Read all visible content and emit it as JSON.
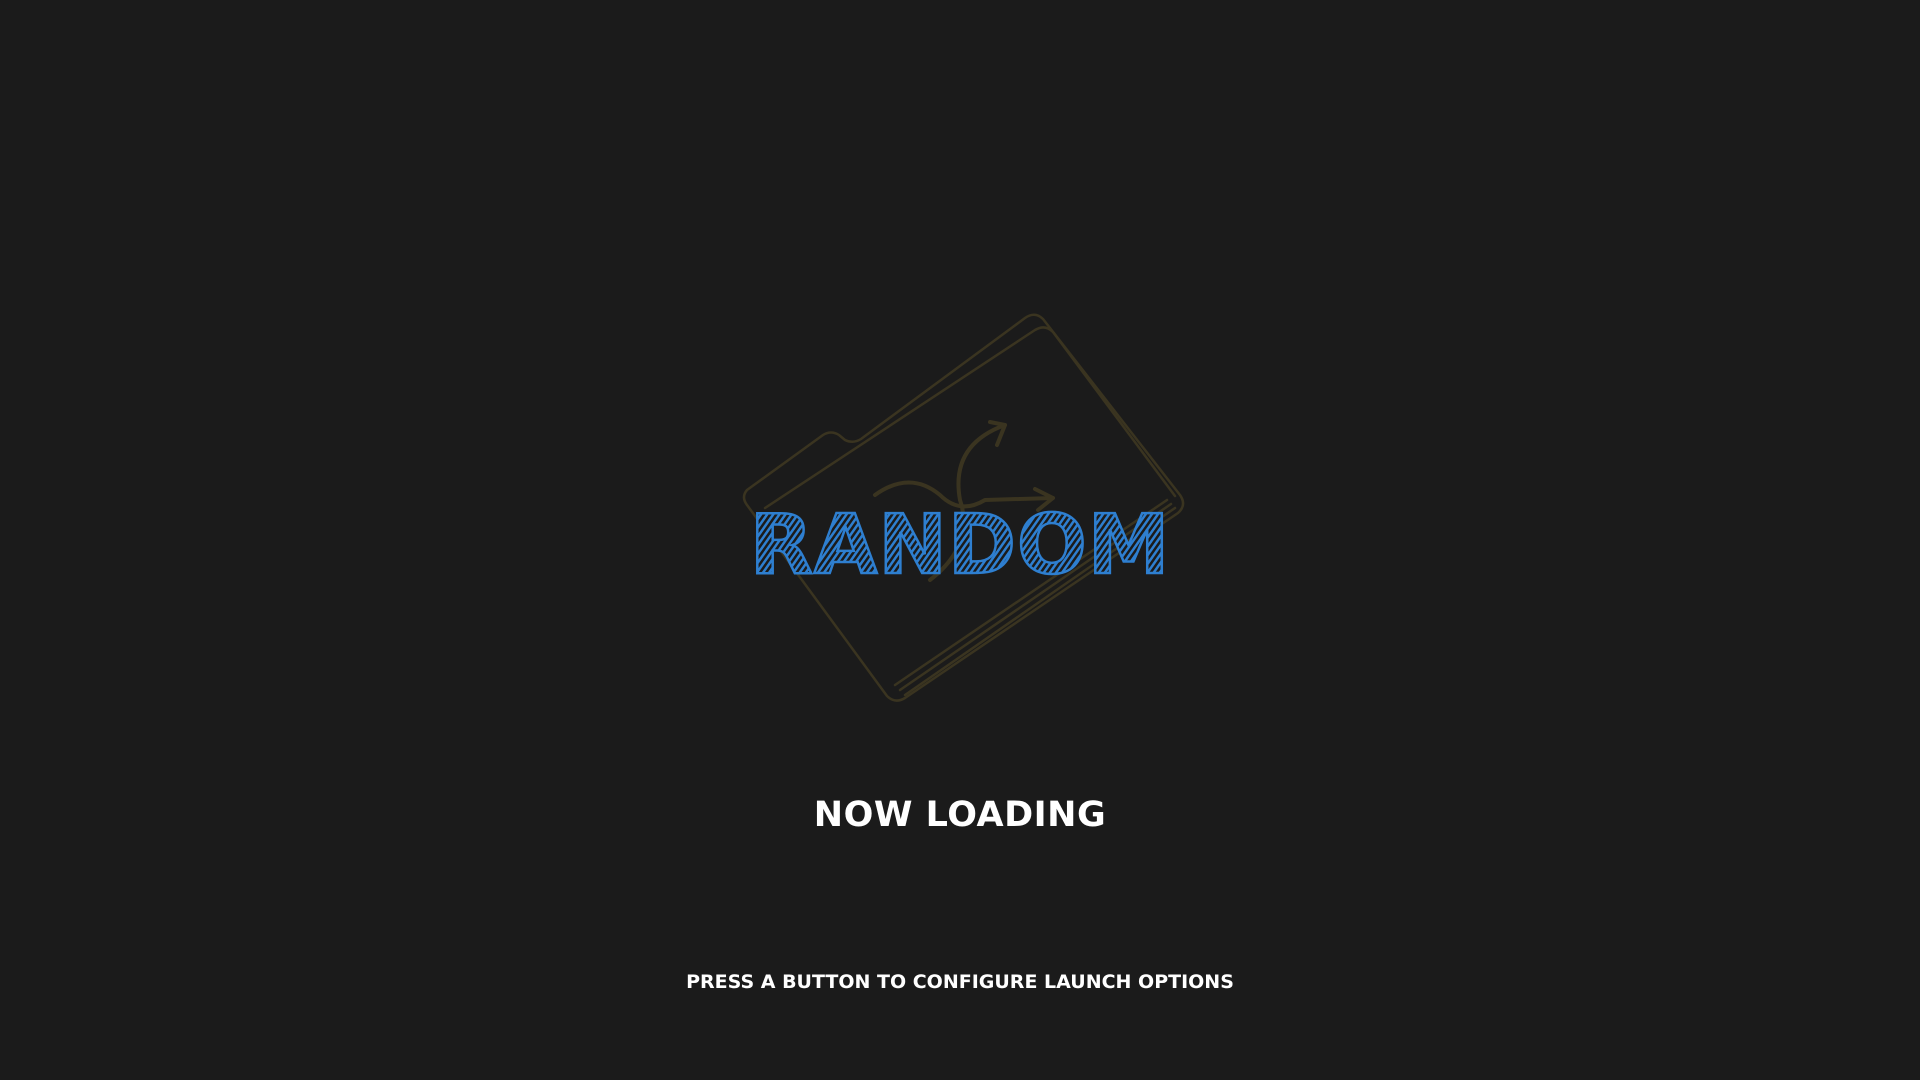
{
  "logo": {
    "title": "RANDOM",
    "color": "#2e7fd0",
    "icon": "folder-random-icon",
    "icon_color": "#3a3420"
  },
  "status": {
    "loading_text": "NOW LOADING"
  },
  "hint": {
    "prompt_text": "PRESS A BUTTON TO CONFIGURE LAUNCH OPTIONS"
  },
  "colors": {
    "background": "#1b1b1b",
    "text": "#ffffff"
  }
}
